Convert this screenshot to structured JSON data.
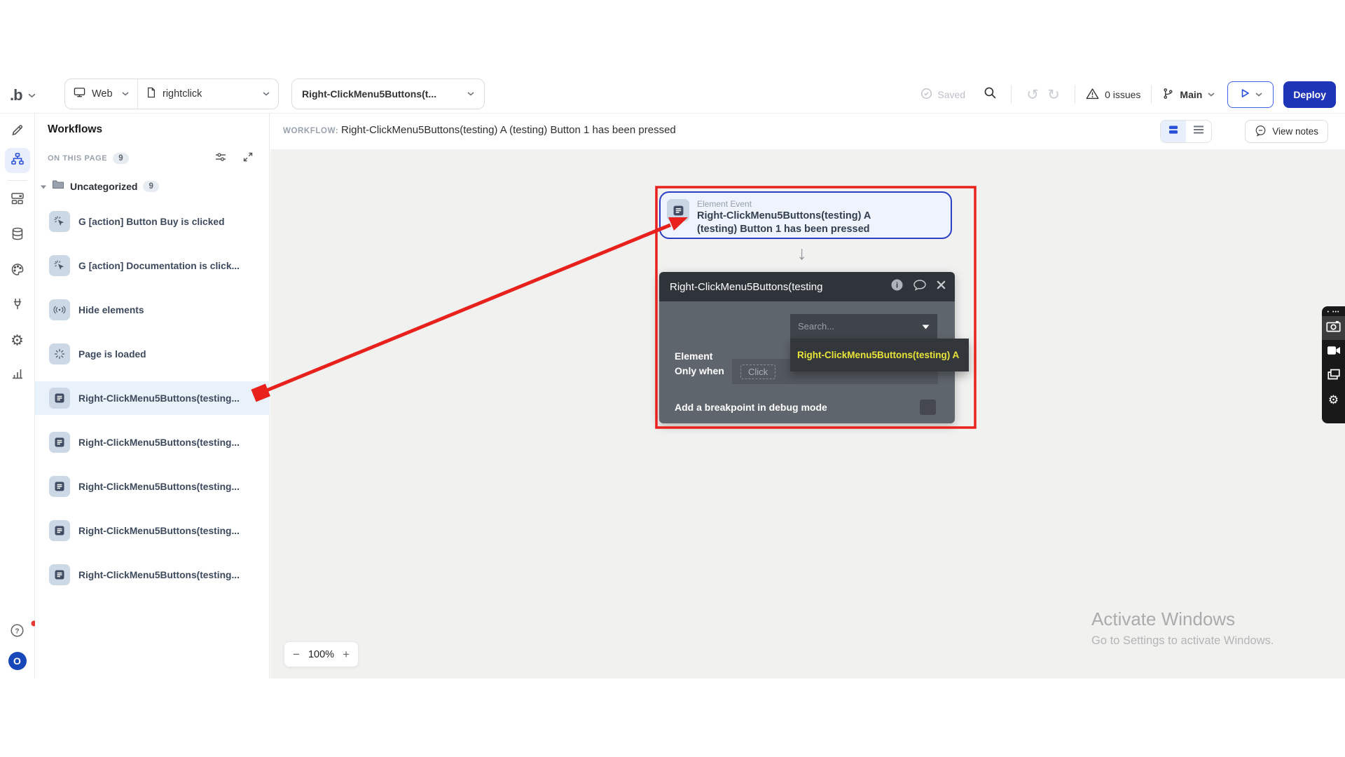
{
  "toolbar": {
    "logo_text": ".b",
    "platform": {
      "label": "Web"
    },
    "page_select": {
      "label": "rightclick"
    },
    "workflow_select": {
      "label": "Right-ClickMenu5Buttons(t..."
    },
    "saved_label": "Saved",
    "undo_glyph": "↺",
    "redo_glyph": "↻",
    "issues_label": "0 issues",
    "branch_label": "Main",
    "deploy_label": "Deploy"
  },
  "sidebar": {
    "active_item": "workflows",
    "avatar_letter": "O"
  },
  "workflows_panel": {
    "title": "Workflows",
    "section_label": "ON THIS PAGE",
    "section_count": "9",
    "folder": {
      "name": "Uncategorized",
      "count": "9"
    },
    "items": [
      {
        "label": "G [action] Button Buy is clicked",
        "icon": "cursor-click",
        "selected": false
      },
      {
        "label": "G [action] Documentation is click...",
        "icon": "cursor-click",
        "selected": false
      },
      {
        "label": "Hide elements",
        "icon": "broadcast",
        "selected": false
      },
      {
        "label": "Page is loaded",
        "icon": "loader",
        "selected": false
      },
      {
        "label": "Right-ClickMenu5Buttons(testing...",
        "icon": "workflow-note",
        "selected": true
      },
      {
        "label": "Right-ClickMenu5Buttons(testing...",
        "icon": "workflow-note",
        "selected": false
      },
      {
        "label": "Right-ClickMenu5Buttons(testing...",
        "icon": "workflow-note",
        "selected": false
      },
      {
        "label": "Right-ClickMenu5Buttons(testing...",
        "icon": "workflow-note",
        "selected": false
      },
      {
        "label": "Right-ClickMenu5Buttons(testing...",
        "icon": "workflow-note",
        "selected": false
      }
    ]
  },
  "canvas_header": {
    "label": "WORKFLOW:",
    "title": "Right-ClickMenu5Buttons(testing) A (testing) Button 1 has been pressed",
    "view_notes_label": "View notes"
  },
  "canvas": {
    "event_node": {
      "kind": "Element Event",
      "title_line1": "Right-ClickMenu5Buttons(testing) A",
      "title_line2": "(testing) Button 1 has been pressed"
    },
    "flow_arrow_glyph": "↓",
    "action_card": {
      "title": "Right-ClickMenu5Buttons(testing",
      "element_label": "Element",
      "search_placeholder": "Search...",
      "dropdown_option": "Right-ClickMenu5Buttons(testing) A",
      "only_when_label": "Only when",
      "only_when_value": "Click",
      "breakpoint_label": "Add a breakpoint in debug mode"
    },
    "zoom_control": {
      "minus": "−",
      "level": "100%",
      "plus": "+"
    }
  },
  "watermark": {
    "line1": "Activate Windows",
    "line2": "Go to Settings to activate Windows."
  },
  "capture_toolbar": {
    "dots": "•••",
    "gear_glyph": "⚙"
  },
  "colors": {
    "accent_blue": "#1e35b8",
    "node_border_blue": "#2b3fc4",
    "selection_row_blue": "#e9f1fb",
    "annotation_red": "#e8211d",
    "dropdown_highlight_yellow": "#e8e438",
    "card_dark_header": "#2f343a",
    "card_gray_body": "#5f656c"
  }
}
